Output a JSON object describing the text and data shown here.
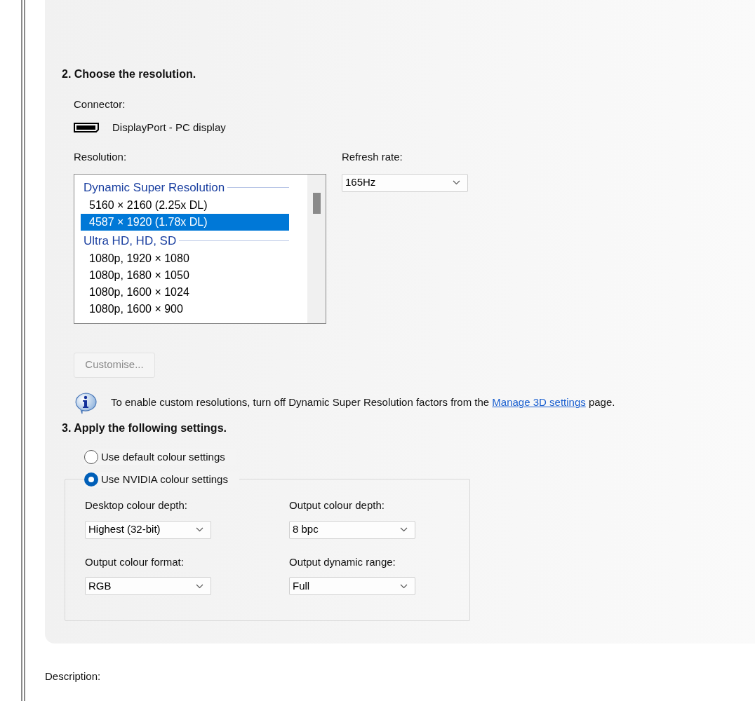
{
  "section2": {
    "heading": "2. Choose the resolution.",
    "connector_label": "Connector:",
    "connector_value": "DisplayPort - PC display",
    "resolution_label": "Resolution:",
    "resolution_list": [
      {
        "kind": "header",
        "text": "Dynamic Super Resolution"
      },
      {
        "kind": "item",
        "text": "5160 × 2160 (2.25x DL)",
        "selected": false
      },
      {
        "kind": "item",
        "text": "4587 × 1920 (1.78x DL)",
        "selected": true
      },
      {
        "kind": "header",
        "text": "Ultra HD, HD, SD"
      },
      {
        "kind": "item",
        "text": "1080p, 1920 × 1080",
        "selected": false
      },
      {
        "kind": "item",
        "text": "1080p, 1680 × 1050",
        "selected": false
      },
      {
        "kind": "item",
        "text": "1080p, 1600 × 1024",
        "selected": false
      },
      {
        "kind": "item",
        "text": "1080p, 1600 × 900",
        "selected": false
      }
    ],
    "refresh_label": "Refresh rate:",
    "refresh_value": "165Hz",
    "customise_button": {
      "label": "Customise...",
      "disabled": true
    },
    "info": {
      "before": "To enable custom resolutions, turn off Dynamic Super Resolution factors from the",
      "link": "Manage 3D settings",
      "after": "page."
    }
  },
  "section3": {
    "heading": "3. Apply the following settings.",
    "options": [
      {
        "label": "Use default colour settings",
        "selected": false
      },
      {
        "label": "Use NVIDIA colour settings",
        "selected": true
      }
    ],
    "dropdowns": [
      {
        "label": "Desktop colour depth:",
        "value": "Highest (32-bit)"
      },
      {
        "label": "Output colour depth:",
        "value": "8 bpc"
      },
      {
        "label": "Output colour format:",
        "value": "RGB"
      },
      {
        "label": "Output dynamic range:",
        "value": "Full"
      }
    ]
  },
  "description_label": "Description:"
}
